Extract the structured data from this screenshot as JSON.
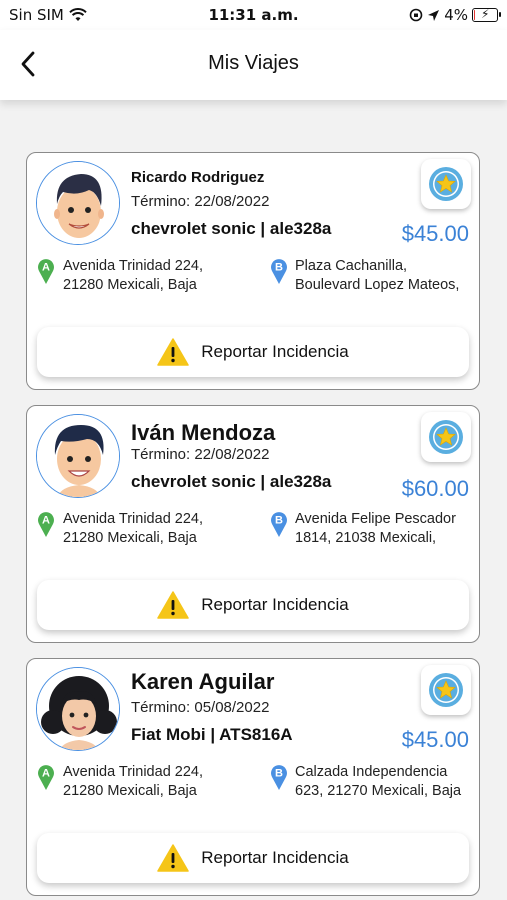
{
  "status_bar": {
    "carrier": "Sin SIM",
    "time": "11:31 a.m.",
    "battery": "4%",
    "icons": [
      "wifi-icon",
      "orientation-lock-icon",
      "location-arrow-icon",
      "battery-charging-icon"
    ]
  },
  "header": {
    "title": "Mis Viajes",
    "back_icon": "chevron-left-icon"
  },
  "colors": {
    "price": "#3b82d6",
    "pin_a": "#4caf50",
    "pin_b": "#4a90e2",
    "warning": "#f5c518",
    "star": "#f5c518",
    "star_badge": "#5aaee0"
  },
  "trips": [
    {
      "driver": "Ricardo Rodriguez",
      "end_date": "Término: 22/08/2022",
      "vehicle": "chevrolet sonic | ale328a",
      "price": "$45.00",
      "origin_label": "A",
      "origin": [
        "Avenida Trinidad 224,",
        "21280 Mexicali, Baja"
      ],
      "destination_label": "B",
      "destination": [
        "Plaza Cachanilla,",
        "Boulevard Lopez Mateos,"
      ],
      "report_label": "Reportar Incidencia"
    },
    {
      "driver": "Iván Mendoza",
      "end_date": "Término: 22/08/2022",
      "vehicle": "chevrolet sonic | ale328a",
      "price": "$60.00",
      "origin_label": "A",
      "origin": [
        "Avenida Trinidad 224,",
        "21280 Mexicali, Baja"
      ],
      "destination_label": "B",
      "destination": [
        "Avenida Felipe Pescador",
        "1814, 21038 Mexicali,"
      ],
      "report_label": "Reportar Incidencia"
    },
    {
      "driver": "Karen Aguilar",
      "end_date": "Término: 05/08/2022",
      "vehicle": "Fiat Mobi | ATS816A",
      "price": "$45.00",
      "origin_label": "A",
      "origin": [
        "Avenida Trinidad 224,",
        "21280 Mexicali, Baja"
      ],
      "destination_label": "B",
      "destination": [
        "Calzada Independencia",
        "623, 21270 Mexicali, Baja"
      ],
      "report_label": "Reportar Incidencia"
    }
  ]
}
